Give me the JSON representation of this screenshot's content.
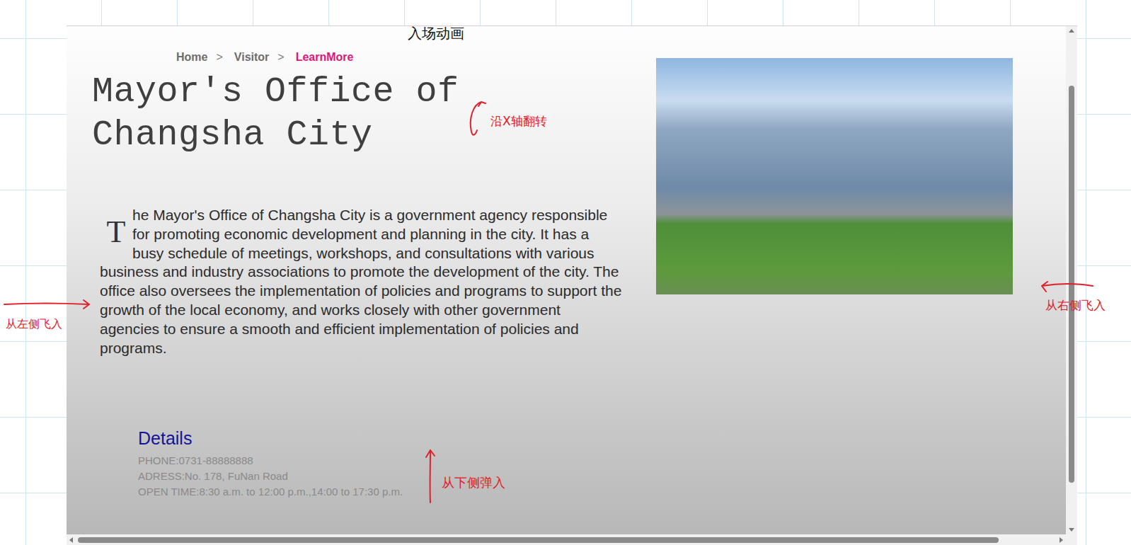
{
  "breadcrumb": {
    "items": [
      {
        "label": "Home",
        "selected": false
      },
      {
        "label": "Visitor",
        "selected": false
      },
      {
        "label": "LearnMore",
        "selected": true
      }
    ],
    "separator": ">"
  },
  "title": "Mayor's Office of Changsha City",
  "paragraph": {
    "drop_cap": "T",
    "text": "he Mayor's Office of Changsha City is a government agency responsible for promoting economic development and planning in the city. It has a busy schedule of meetings, workshops, and consultations with various business and industry associations to promote the development of the city. The office also oversees the implementation of policies and programs to support the growth of the local economy, and works closely with other government agencies to ensure a smooth and efficient implementation of policies and programs."
  },
  "details": {
    "heading": "Details",
    "lines": [
      "PHONE:0731-88888888",
      "ADRESS:No. 178, FuNan Road",
      "OPEN TIME:8:30 a.m. to 12:00 p.m.,14:00 to 17:30 p.m."
    ]
  },
  "annotations": [
    {
      "text": "入场动画",
      "kind": "label",
      "color": "#111111"
    },
    {
      "text": "沿X轴翻转",
      "kind": "flip",
      "color": "#e0202a"
    },
    {
      "text": "从左侧飞入",
      "kind": "right",
      "color": "#e0202a"
    },
    {
      "text": "从右侧飞入",
      "kind": "left",
      "color": "#e0202a"
    },
    {
      "text": "从下侧弹入",
      "kind": "up",
      "color": "#e0202a"
    }
  ]
}
